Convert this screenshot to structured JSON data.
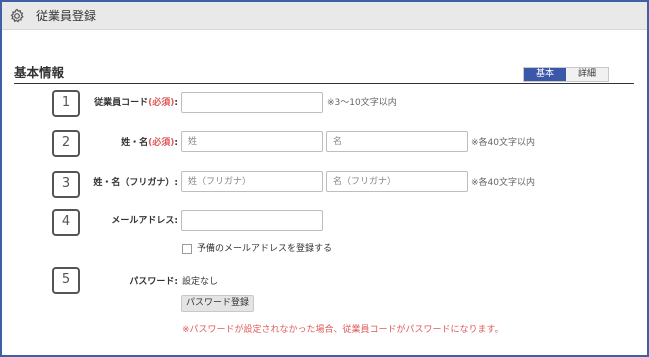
{
  "window": {
    "title": "従業員登録",
    "icon": "gear-icon"
  },
  "section": {
    "title": "基本情報"
  },
  "tabs": [
    {
      "label": "基本",
      "active": true
    },
    {
      "label": "詳細",
      "active": false
    }
  ],
  "steps": [
    "1",
    "2",
    "3",
    "4",
    "5"
  ],
  "employee_code": {
    "label": "従業員コード",
    "required": "(必須)",
    "colon": ":",
    "value": "",
    "hint": "※3～10文字以内"
  },
  "name": {
    "label": "姓・名",
    "required": "(必須)",
    "colon": ":",
    "last_placeholder": "姓",
    "first_placeholder": "名",
    "hint": "※各40文字以内"
  },
  "name_kana": {
    "label": "姓・名（フリガナ）:",
    "last_placeholder": "姓（フリガナ）",
    "first_placeholder": "名（フリガナ）",
    "hint": "※各40文字以内"
  },
  "email": {
    "label": "メールアドレス:",
    "value": "",
    "backup_checkbox_label": "予備のメールアドレスを登録する",
    "backup_checked": false
  },
  "password": {
    "label": "パスワード:",
    "status": "設定なし",
    "button_label": "パスワード登録",
    "note": "※パスワードが設定されなかった場合、従業員コードがパスワードになります。"
  },
  "colors": {
    "frame_border": "#3f5fa8",
    "tab_active": "#3a57a8",
    "required_red": "#e05a5a",
    "titlebar_bg": "#e9e9e9"
  }
}
